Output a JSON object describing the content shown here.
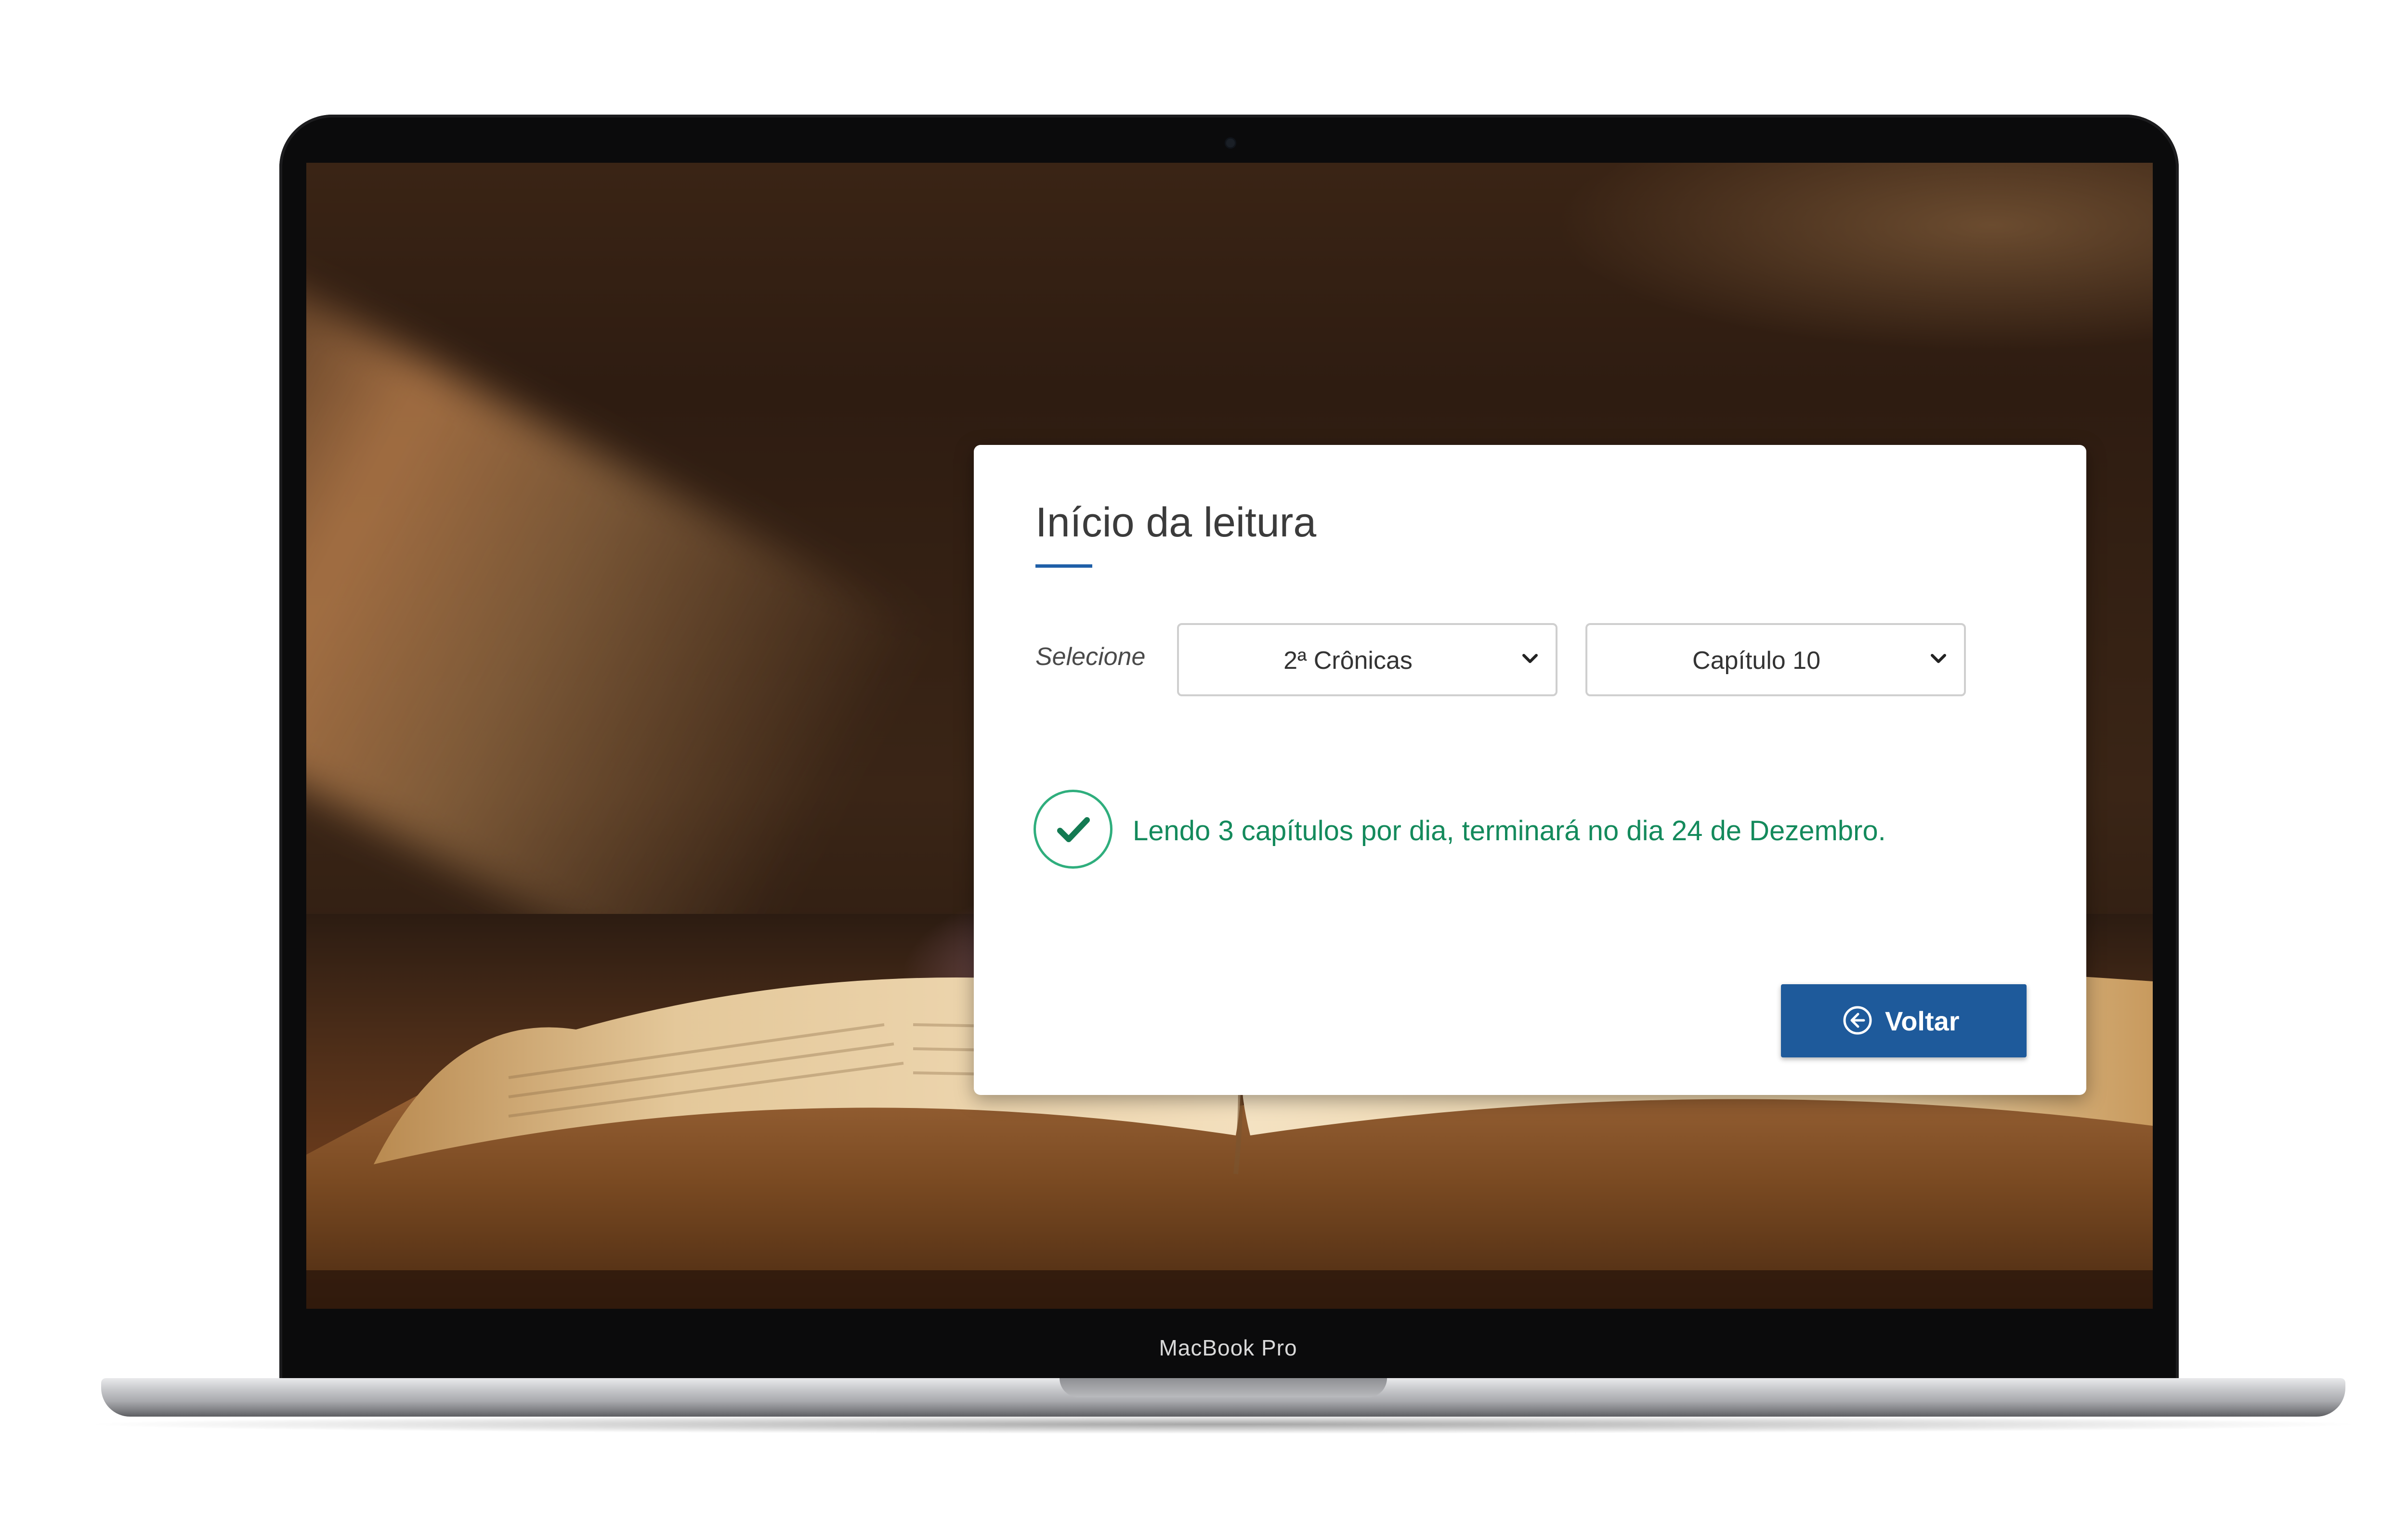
{
  "device": {
    "label": "MacBook Pro"
  },
  "modal": {
    "title": "Início da leitura",
    "select_label": "Selecione",
    "book_select": {
      "value": "2ª Crônicas"
    },
    "chapter_select": {
      "value": "Capítulo 10"
    },
    "status_message": "Lendo 3 capítulos por dia, terminará no dia 24 de Dezembro.",
    "back_button_label": "Voltar"
  },
  "colors": {
    "accent_blue": "#1e5a9b",
    "success_green": "#148a5c",
    "title_underline": "#1f5fa8"
  },
  "icons": {
    "status": "check-circle-icon",
    "back": "arrow-left-circle-icon",
    "select": "chevron-down-icon"
  }
}
